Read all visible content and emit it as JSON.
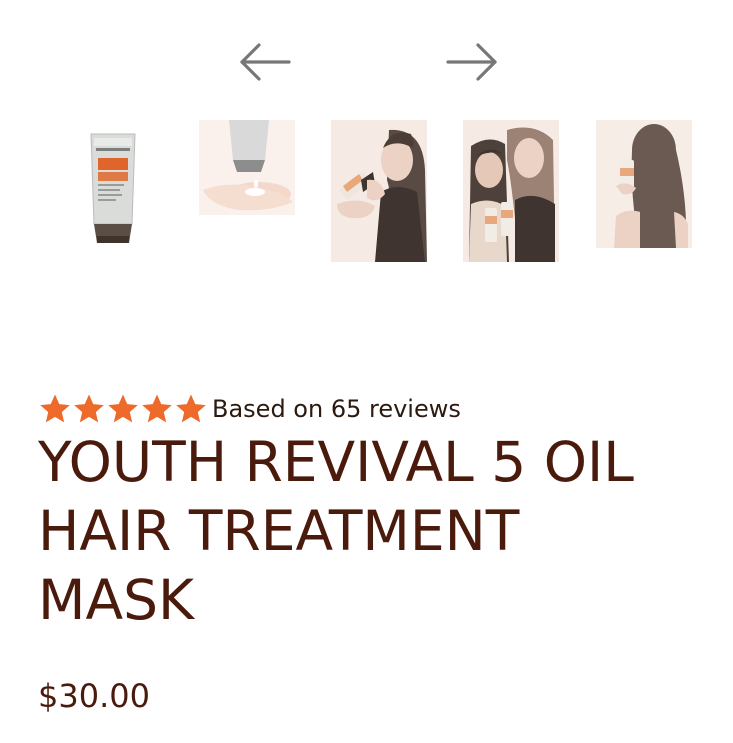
{
  "gallery": {
    "prev_icon": "arrow-left-icon",
    "next_icon": "arrow-right-icon",
    "thumbnails": [
      {
        "icon": "product-tube-image"
      },
      {
        "icon": "product-in-hand-image"
      },
      {
        "icon": "model-applying-product-image"
      },
      {
        "icon": "two-models-with-product-image"
      },
      {
        "icon": "model-long-hair-back-image"
      }
    ]
  },
  "rating": {
    "stars": 5,
    "star_color": "#ee6a2a",
    "text": "Based on 65 reviews"
  },
  "product": {
    "title_line1": "YOUTH REVIVAL 5 OIL",
    "title_line2": "HAIR TREATMENT",
    "title_line3": "MASK",
    "price": "$30.00",
    "title_color": "#4a1b0c"
  }
}
